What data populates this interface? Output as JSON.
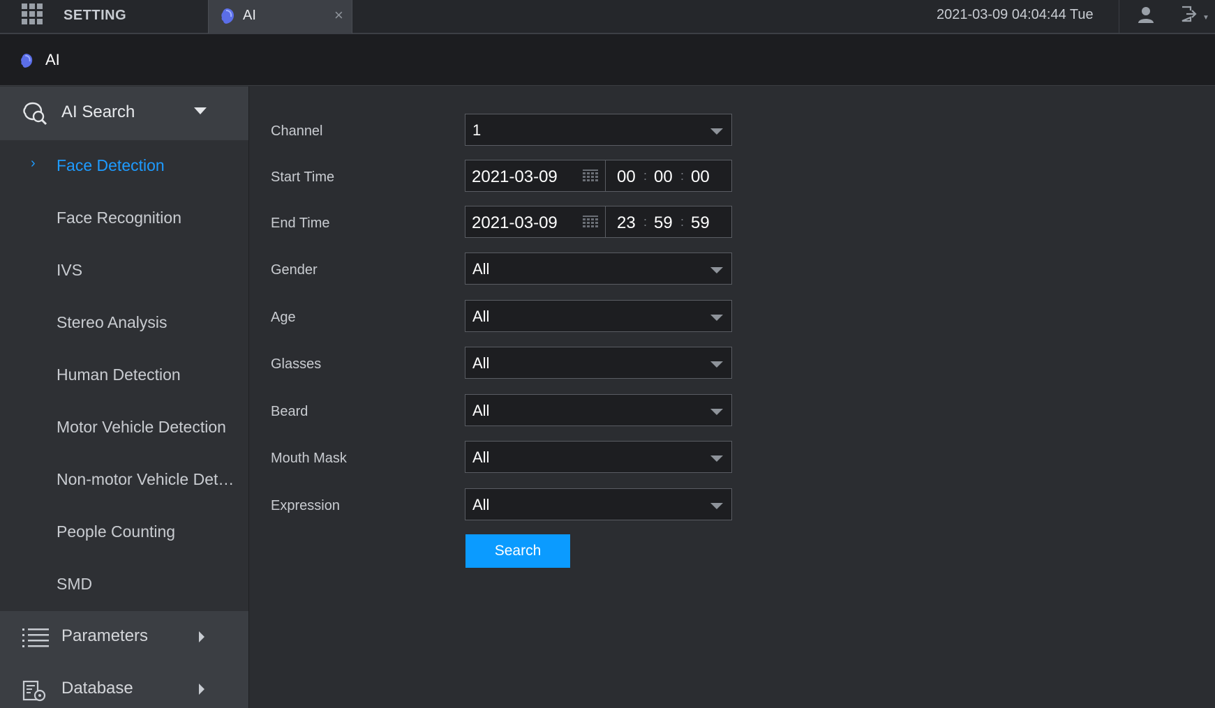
{
  "topbar": {
    "app_name": "SETTING",
    "tab_label": "AI",
    "tab_close": "×",
    "datetime": "2021-03-09 04:04:44 Tue"
  },
  "page_header": {
    "title": "AI"
  },
  "sidebar": {
    "ai_search": {
      "label": "AI Search",
      "items": [
        "Face Detection",
        "Face Recognition",
        "IVS",
        "Stereo Analysis",
        "Human Detection",
        "Motor Vehicle Detection",
        "Non-motor Vehicle Detection",
        "People Counting",
        "SMD"
      ],
      "active_index": 0
    },
    "parameters": {
      "label": "Parameters"
    },
    "database": {
      "label": "Database"
    }
  },
  "form": {
    "channel": {
      "label": "Channel",
      "value": "1"
    },
    "start_time": {
      "label": "Start Time",
      "date": "2021-03-09",
      "hh": "00",
      "mm": "00",
      "ss": "00"
    },
    "end_time": {
      "label": "End Time",
      "date": "2021-03-09",
      "hh": "23",
      "mm": "59",
      "ss": "59"
    },
    "gender": {
      "label": "Gender",
      "value": "All"
    },
    "age": {
      "label": "Age",
      "value": "All"
    },
    "glasses": {
      "label": "Glasses",
      "value": "All"
    },
    "beard": {
      "label": "Beard",
      "value": "All"
    },
    "mouth_mask": {
      "label": "Mouth Mask",
      "value": "All"
    },
    "expression": {
      "label": "Expression",
      "value": "All"
    },
    "search_label": "Search"
  },
  "colors": {
    "accent": "#1e9bff",
    "button": "#0b9bff",
    "background": "#2b2d31",
    "sidebar_group": "#3b3e43"
  }
}
